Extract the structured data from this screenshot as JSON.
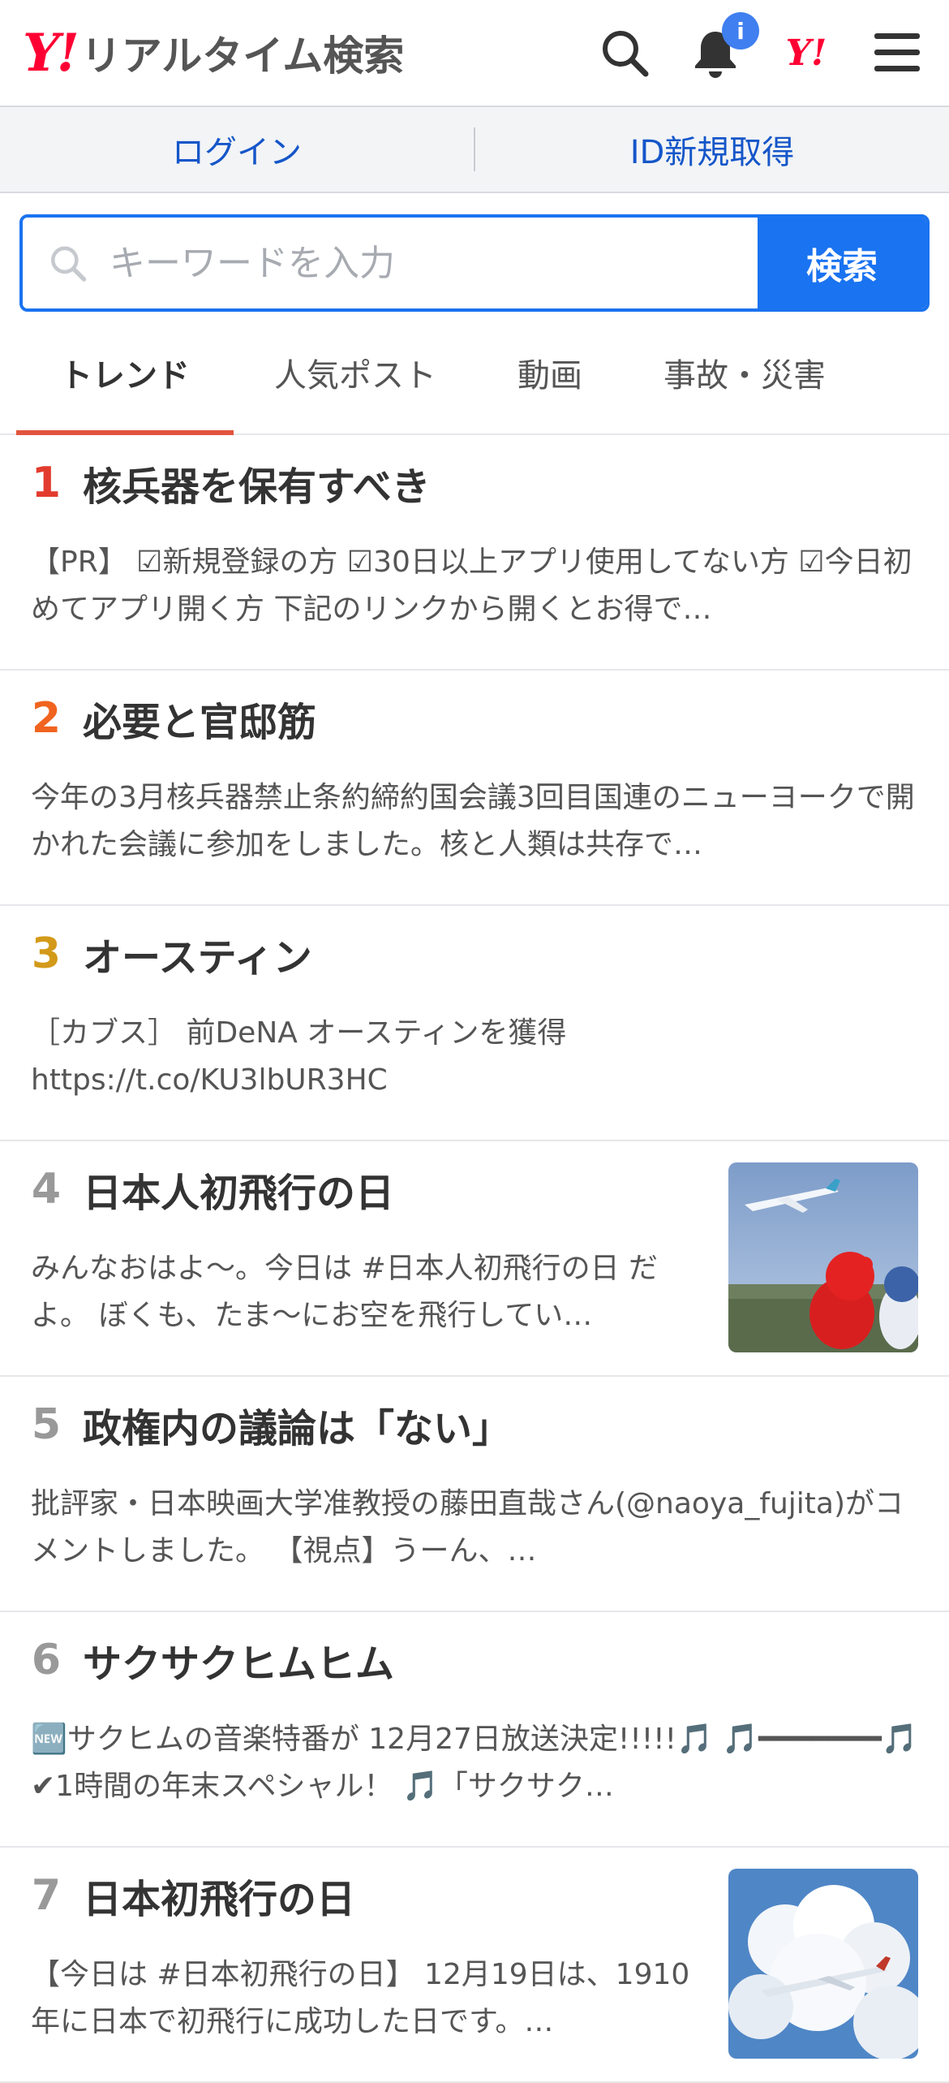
{
  "header": {
    "logo_mark": "Y!",
    "logo_text": "リアルタイム検索",
    "badge": "i",
    "corp_logo": "Y!"
  },
  "auth": {
    "login": "ログイン",
    "register": "ID新規取得"
  },
  "search": {
    "placeholder": "キーワードを入力",
    "value": "",
    "button": "検索"
  },
  "tabs": [
    "トレンド",
    "人気ポスト",
    "動画",
    "事故・災害"
  ],
  "trends": [
    {
      "rank": "1",
      "title": "核兵器を保有すべき",
      "snippet": "【PR】 ☑新規登録の方 ☑30日以上アプリ使用してない方 ☑今日初めてアプリ開く方 下記のリンクから開くとお得で…",
      "rank_color": "#e23b2e"
    },
    {
      "rank": "2",
      "title": "必要と官邸筋",
      "snippet": "今年の3月核兵器禁止条約締約国会議3回目国連のニューヨークで開かれた会議に参加をしました。核と人類は共存で…",
      "rank_color": "#f0641f"
    },
    {
      "rank": "3",
      "title": "オースティン",
      "snippet": "［カブス］ 前DeNA オースティンを獲得 https://t.co/KU3lbUR3HC",
      "rank_color": "#d39a1a"
    },
    {
      "rank": "4",
      "title": "日本人初飛行の日",
      "snippet": "みんなおはよ〜。今日は #日本人初飛行の日 だよ。 ぼくも、たま〜にお空を飛行してい…",
      "rank_color": "#999999"
    },
    {
      "rank": "5",
      "title": "政権内の議論は「ない」",
      "snippet": "批評家・日本映画大学准教授の藤田直哉さん(@naoya_fujita)がコメントしました。 【視点】うーん、…",
      "rank_color": "#999999"
    },
    {
      "rank": "6",
      "title": "サクサクヒムヒム",
      "snippet": "🆕サクヒムの音楽特番が 12月27日放送決定!!!!!🎵 🎵━━━━━━━🎵 ✔1時間の年末スペシャル！ 🎵「サクサク…",
      "rank_color": "#999999"
    },
    {
      "rank": "7",
      "title": "日本初飛行の日",
      "snippet": "【今日は #日本初飛行の日】 12月19日は、1910年に日本で初飛行に成功した日です。…",
      "rank_color": "#999999"
    }
  ]
}
